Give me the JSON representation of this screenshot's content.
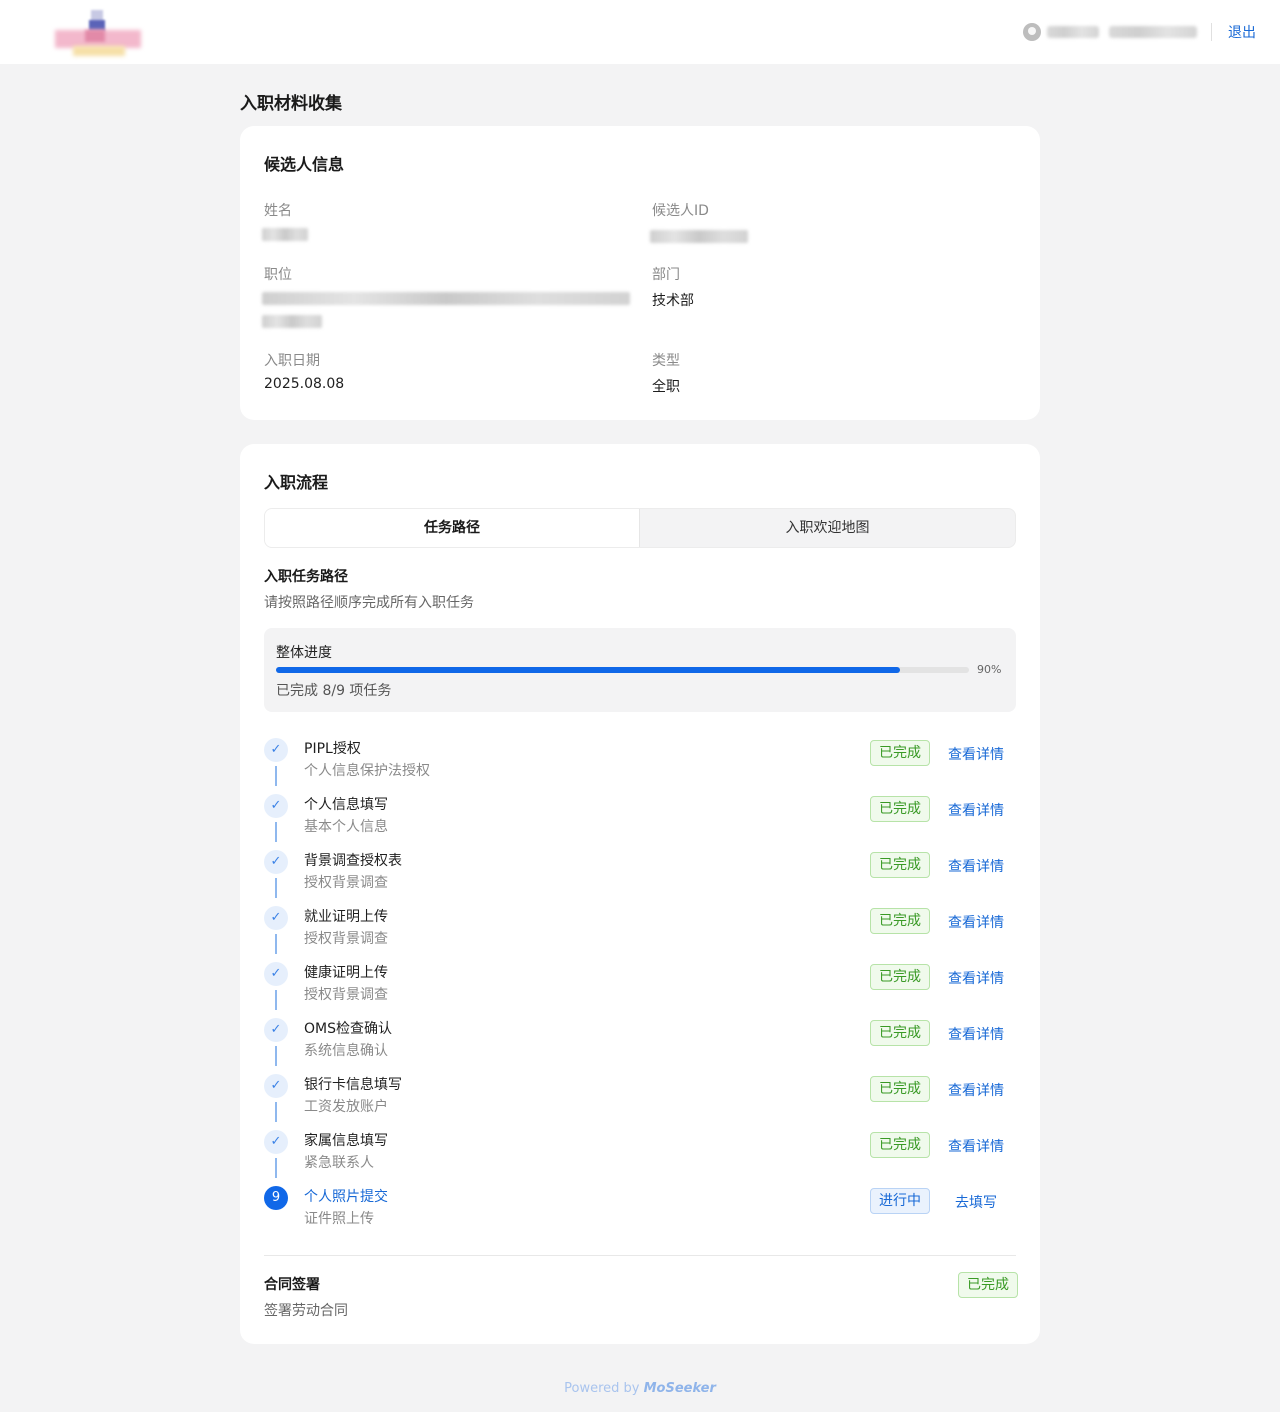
{
  "header": {
    "logout_label": "退出"
  },
  "page_title": "入职材料收集",
  "candidate": {
    "title": "候选人信息",
    "name_label": "姓名",
    "id_label": "候选人ID",
    "position_label": "职位",
    "department_label": "部门",
    "department_value": "技术部",
    "start_date_label": "入职日期",
    "start_date_value": "2025.08.08",
    "type_label": "类型",
    "type_value": "全职"
  },
  "process": {
    "title": "入职流程",
    "tabs": [
      {
        "label": "任务路径",
        "active": true
      },
      {
        "label": "入职欢迎地图",
        "active": false
      }
    ],
    "path_title": "入职任务路径",
    "path_desc": "请按照路径顺序完成所有入职任务",
    "progress": {
      "label": "整体进度",
      "percent": 90,
      "percent_text": "90%",
      "note": "已完成 8/9 项任务"
    },
    "steps": [
      {
        "name": "PIPL授权",
        "desc": "个人信息保护法授权",
        "status": "已完成",
        "action": "查看详情"
      },
      {
        "name": "个人信息填写",
        "desc": "基本个人信息",
        "status": "已完成",
        "action": "查看详情"
      },
      {
        "name": "背景调查授权表",
        "desc": "授权背景调查",
        "status": "已完成",
        "action": "查看详情"
      },
      {
        "name": "就业证明上传",
        "desc": "授权背景调查",
        "status": "已完成",
        "action": "查看详情"
      },
      {
        "name": "健康证明上传",
        "desc": "授权背景调查",
        "status": "已完成",
        "action": "查看详情"
      },
      {
        "name": "OMS检查确认",
        "desc": "系统信息确认",
        "status": "已完成",
        "action": "查看详情"
      },
      {
        "name": "银行卡信息填写",
        "desc": "工资发放账户",
        "status": "已完成",
        "action": "查看详情"
      },
      {
        "name": "家属信息填写",
        "desc": "紧急联系人",
        "status": "已完成",
        "action": "查看详情"
      },
      {
        "name": "个人照片提交",
        "desc": "证件照上传",
        "status": "进行中",
        "action": "去填写",
        "number": "9"
      }
    ],
    "contract": {
      "title": "合同签署",
      "desc": "签署劳动合同",
      "status": "已完成"
    }
  },
  "footer": {
    "prefix": "Powered by",
    "brand": "MoSeeker"
  },
  "colors": {
    "accent": "#1068e8",
    "done_green": "#3a9a26",
    "background": "#f3f3f4"
  },
  "icons": {
    "step_done": "check-icon",
    "user": "user-avatar-icon"
  }
}
